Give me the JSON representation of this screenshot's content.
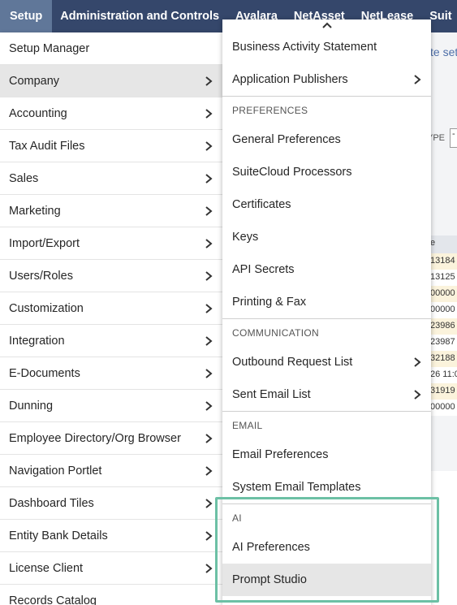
{
  "topnav": {
    "tabs": [
      {
        "label": "Setup",
        "active": true
      },
      {
        "label": "Administration and Controls"
      },
      {
        "label": "Avalara"
      },
      {
        "label": "NetAsset"
      },
      {
        "label": "NetLease"
      },
      {
        "label": "Suit"
      }
    ]
  },
  "left_menu": {
    "items": [
      {
        "label": "Setup Manager",
        "has_submenu": false
      },
      {
        "label": "Company",
        "has_submenu": true,
        "selected": true
      },
      {
        "label": "Accounting",
        "has_submenu": true
      },
      {
        "label": "Tax Audit Files",
        "has_submenu": true
      },
      {
        "label": "Sales",
        "has_submenu": true
      },
      {
        "label": "Marketing",
        "has_submenu": true
      },
      {
        "label": "Import/Export",
        "has_submenu": true
      },
      {
        "label": "Users/Roles",
        "has_submenu": true
      },
      {
        "label": "Customization",
        "has_submenu": true
      },
      {
        "label": "Integration",
        "has_submenu": true
      },
      {
        "label": "E-Documents",
        "has_submenu": true
      },
      {
        "label": "Dunning",
        "has_submenu": true
      },
      {
        "label": "Employee Directory/Org Browser",
        "has_submenu": true
      },
      {
        "label": "Navigation Portlet",
        "has_submenu": true
      },
      {
        "label": "Dashboard Tiles",
        "has_submenu": true
      },
      {
        "label": "Entity Bank Details",
        "has_submenu": true
      },
      {
        "label": "License Client",
        "has_submenu": true
      },
      {
        "label": "Records Catalog",
        "has_submenu": false
      }
    ]
  },
  "sub_menu": {
    "top_items": [
      {
        "label": "Business Activity Statement",
        "has_submenu": false
      },
      {
        "label": "Application Publishers",
        "has_submenu": true
      }
    ],
    "sections": [
      {
        "header": "PREFERENCES",
        "items": [
          {
            "label": "General Preferences",
            "has_submenu": false
          },
          {
            "label": "SuiteCloud Processors",
            "has_submenu": false
          },
          {
            "label": "Certificates",
            "has_submenu": false
          },
          {
            "label": "Keys",
            "has_submenu": false
          },
          {
            "label": "API Secrets",
            "has_submenu": false
          },
          {
            "label": "Printing & Fax",
            "has_submenu": false
          }
        ]
      },
      {
        "header": "COMMUNICATION",
        "items": [
          {
            "label": "Outbound Request List",
            "has_submenu": true
          },
          {
            "label": "Sent Email List",
            "has_submenu": true
          }
        ]
      },
      {
        "header": "EMAIL",
        "items": [
          {
            "label": "Email Preferences",
            "has_submenu": false
          },
          {
            "label": "System Email Templates",
            "has_submenu": false
          }
        ]
      },
      {
        "header": "AI",
        "items": [
          {
            "label": "AI Preferences",
            "has_submenu": false
          },
          {
            "label": "Prompt Studio",
            "has_submenu": false,
            "hovered": true
          }
        ]
      }
    ]
  },
  "background": {
    "link_text": "te set",
    "type_label": "YPE",
    "type_select_value": "-",
    "column_header": "e",
    "rows": [
      "13184",
      "13125",
      "00000",
      "00000",
      "23986",
      "23987",
      "32188",
      "26 11:0",
      "31919",
      "00000"
    ]
  },
  "colors": {
    "topnav_bg": "#35476b",
    "topnav_active_bg": "#607799",
    "menu_highlight": "#e6e6e6",
    "callout_border": "#6cc0a5"
  }
}
